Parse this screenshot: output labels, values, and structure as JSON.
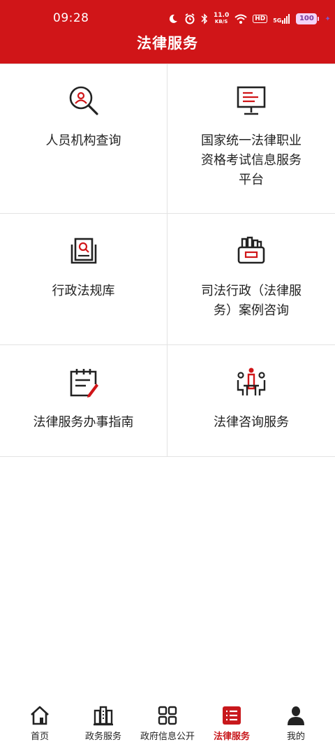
{
  "status_bar": {
    "time": "09:28",
    "net_speed_value": "11.0",
    "net_speed_unit": "KB/S",
    "hd": "HD",
    "network": "5G",
    "battery": "100"
  },
  "header": {
    "title": "法律服务"
  },
  "services": [
    {
      "label": "人员机构查询",
      "icon": "person-search-icon"
    },
    {
      "label": "国家统一法律职业资格考试信息服务平台",
      "icon": "monitor-icon"
    },
    {
      "label": "行政法规库",
      "icon": "document-search-icon"
    },
    {
      "label": "司法行政（法律服务）案例咨询",
      "icon": "case-folder-icon"
    },
    {
      "label": "法律服务办事指南",
      "icon": "calendar-pen-icon"
    },
    {
      "label": "法律咨询服务",
      "icon": "consultation-icon"
    }
  ],
  "tabbar": [
    {
      "label": "首页",
      "icon": "home-icon"
    },
    {
      "label": "政务服务",
      "icon": "buildings-icon"
    },
    {
      "label": "政府信息公开",
      "icon": "grid-icon"
    },
    {
      "label": "法律服务",
      "icon": "list-icon",
      "active": true
    },
    {
      "label": "我的",
      "icon": "user-icon"
    }
  ],
  "colors": {
    "brand_red": "#d01518",
    "active_tab": "#c8181c",
    "divider": "#e3e3e3"
  }
}
